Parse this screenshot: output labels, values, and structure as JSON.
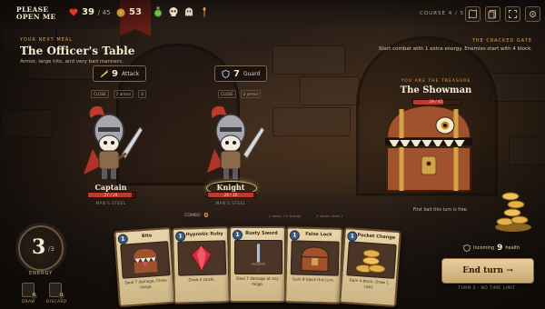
{
  "app": {
    "logo_line1": "PLEASE",
    "logo_line2": "OPEN ME"
  },
  "player": {
    "hp": "39",
    "hp_max": "/ 45",
    "gold": "53",
    "energy": "3",
    "energy_max": "/3",
    "energy_label": "ENERGY"
  },
  "topbar": {
    "course": "COURSE  4 / 5",
    "relics": [
      "potion-icon",
      "skull-icon",
      "ghost-icon",
      "torch-icon"
    ]
  },
  "encounter": {
    "kicker": "YOUR NEXT MEAL",
    "title": "The Officer's Table",
    "subtitle": "Armor, large hits, and very bad manners."
  },
  "modifier": {
    "title": "THE CRACKED GATE",
    "text1": "Start combat with 1 extra energy. Enemies start with 4 block."
  },
  "enemies": [
    {
      "name": "Captain",
      "hp": "27 / 29",
      "hp_pct": 0.93,
      "intent_value": "9",
      "intent_label": "Attack",
      "tags": [
        "CLOSE",
        "2 armor",
        "4"
      ],
      "status": "MAN'S STEEL"
    },
    {
      "name": "Knight",
      "hp": "29 / 30",
      "hp_pct": 0.97,
      "intent_value": "7",
      "intent_label": "Guard",
      "tags": [
        "CLOSE",
        "2 armor"
      ],
      "status": "MAN'S STEEL"
    }
  ],
  "boss": {
    "kicker": "YOU ARE THE TREASURE",
    "name": "The Showman",
    "hp": "29 / 45",
    "hp_pct": 0.64,
    "note": "First bait this turn is free."
  },
  "combo": {
    "label": "COMBO",
    "value": "0",
    "info1": "1 cards: +1 energy",
    "info2": "3 cards: draw 1"
  },
  "piles": {
    "draw_count": "6",
    "draw_label": "DRAW",
    "discard_count": "0",
    "discard_label": "DISCARD"
  },
  "hand": [
    {
      "cost": "1",
      "name": "Bite",
      "desc": "Deal 7 damage. Close range.",
      "art": "mimic-icon"
    },
    {
      "cost": "1",
      "name": "Hypnotic Ruby",
      "desc": "Draw 2 cards.",
      "art": "ruby-icon"
    },
    {
      "cost": "1",
      "name": "Rusty Sword",
      "desc": "Deal 7 damage at any range.",
      "art": "sword-icon"
    },
    {
      "cost": "1",
      "name": "False Lock",
      "desc": "Gain 8 block this turn.",
      "art": "chest-icon"
    },
    {
      "cost": "1",
      "name": "Pocket Change",
      "desc": "Gain 4 block. Draw 1 card.",
      "art": "coins-icon"
    }
  ],
  "incoming": {
    "label": "Incoming",
    "value": "9",
    "unit": "health"
  },
  "end_turn": {
    "label": "End turn →",
    "note": "TURN 2 · NO TIME LIMIT"
  },
  "colors": {
    "accent": "#e0a34a",
    "hp": "#c0392b",
    "card": "#e8d5aa"
  }
}
